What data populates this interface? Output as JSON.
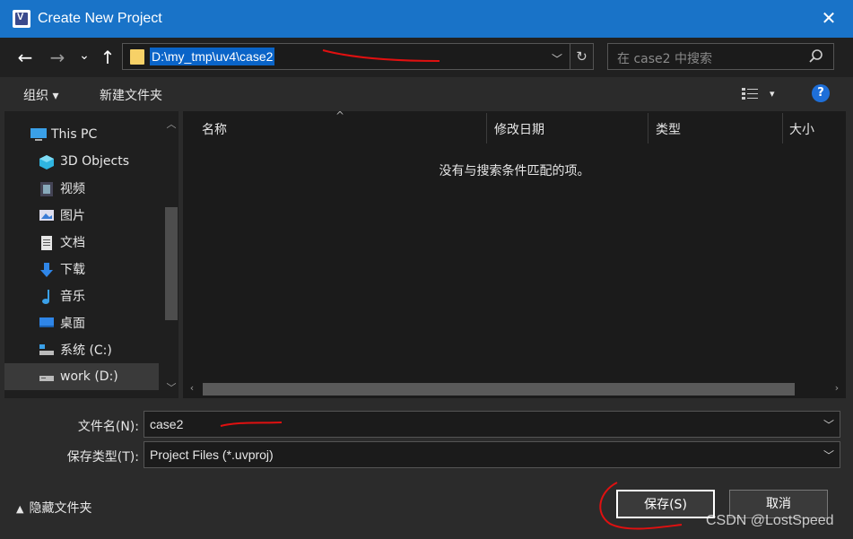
{
  "window": {
    "title": "Create New Project",
    "close": "✕"
  },
  "nav": {
    "back": "←",
    "forward": "→",
    "recent": "⌄",
    "up": "↑",
    "address": "D:\\my_tmp\\uv4\\case2",
    "search_placeholder": "在 case2 中搜索"
  },
  "toolbar": {
    "organize": "组织 ▾",
    "new_folder": "新建文件夹",
    "view": "▾",
    "help": "?"
  },
  "sidebar": {
    "items": [
      {
        "label": "This PC",
        "icon": "computer-icon"
      },
      {
        "label": "3D Objects",
        "icon": "cube-icon"
      },
      {
        "label": "视频",
        "icon": "video-icon"
      },
      {
        "label": "图片",
        "icon": "picture-icon"
      },
      {
        "label": "文档",
        "icon": "document-icon"
      },
      {
        "label": "下载",
        "icon": "download-icon"
      },
      {
        "label": "音乐",
        "icon": "music-icon"
      },
      {
        "label": "桌面",
        "icon": "desktop-icon"
      },
      {
        "label": "系统 (C:)",
        "icon": "drive-icon"
      },
      {
        "label": "work (D:)",
        "icon": "drive-icon",
        "selected": true
      }
    ]
  },
  "filelist": {
    "columns": [
      "名称",
      "修改日期",
      "类型",
      "大小"
    ],
    "empty_message": "没有与搜索条件匹配的项。"
  },
  "form": {
    "filename_label": "文件名(N):",
    "filename_value": "case2",
    "filetype_label": "保存类型(T):",
    "filetype_value": "Project Files (*.uvproj)",
    "hide_folders": "隐藏文件夹",
    "save": "保存(S)",
    "cancel": "取消"
  },
  "watermark": "CSDN @LostSpeed",
  "colors": {
    "titlebar": "#1973c8",
    "selection": "#0a64c8",
    "annotation": "#e01010"
  }
}
